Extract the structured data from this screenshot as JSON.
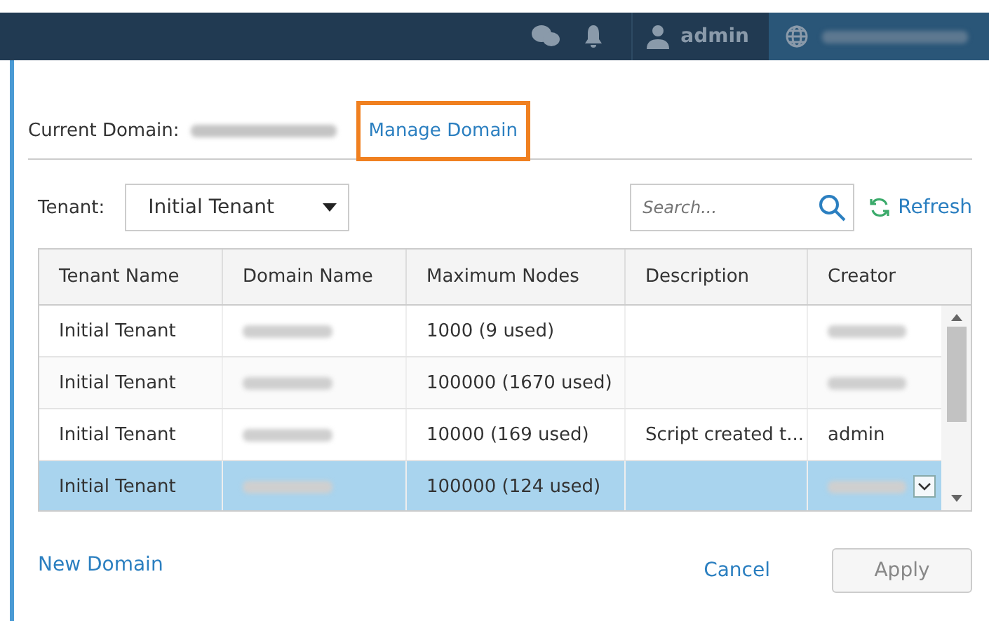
{
  "top_bar": {
    "user": "admin",
    "domain": {
      "redacted": true
    }
  },
  "current_domain": {
    "label": "Current Domain:",
    "value": {
      "redacted": true
    },
    "link": "Manage Domain"
  },
  "tenant_filter": {
    "label": "Tenant:",
    "value": "Initial Tenant"
  },
  "search": {
    "placeholder": "Search..."
  },
  "refresh": "Refresh",
  "table": {
    "columns": [
      "Tenant Name",
      "Domain Name",
      "Maximum Nodes",
      "Description",
      "Creator"
    ],
    "rows": [
      {
        "selected": false,
        "cells": [
          "Initial Tenant",
          {
            "redacted": true
          },
          "1000 (9 used)",
          "",
          {
            "redacted": true
          }
        ]
      },
      {
        "selected": false,
        "cells": [
          "Initial Tenant",
          {
            "redacted": true
          },
          "100000 (1670 used)",
          "",
          {
            "redacted": true
          }
        ]
      },
      {
        "selected": false,
        "cells": [
          "Initial Tenant",
          {
            "redacted": true
          },
          "10000 (169 used)",
          "Script created t...",
          "admin"
        ]
      },
      {
        "selected": true,
        "cells": [
          "Initial Tenant",
          {
            "redacted": true
          },
          "100000 (124 used)",
          "",
          {
            "redacted": true
          }
        ]
      }
    ]
  },
  "footer": {
    "new_domain": "New Domain",
    "cancel": "Cancel",
    "apply": {
      "label": "Apply",
      "disabled": true
    }
  }
}
